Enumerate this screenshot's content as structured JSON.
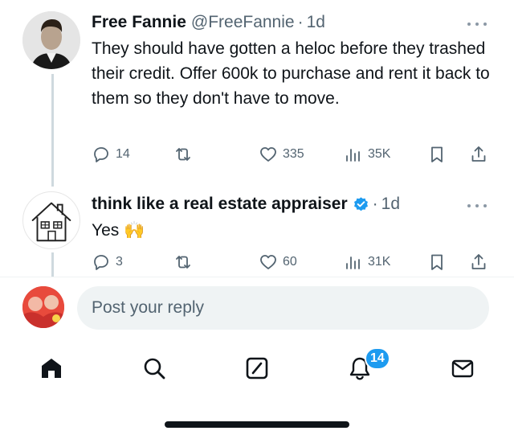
{
  "tweets": [
    {
      "name": "Free Fannie",
      "handle": "@FreeFannie",
      "separator": "·",
      "time": "1d",
      "text": "They should have gotten a heloc before they trashed their credit. Offer 600k to purchase and rent it back to them so they don't have to move.",
      "replies": "14",
      "likes": "335",
      "views": "35K",
      "avatar_icon": "user-photo-avatar"
    },
    {
      "name": "think like a real estate appraiser",
      "verified": true,
      "separator": "·",
      "time": "1d",
      "text": "Yes 🙌",
      "replies": "3",
      "likes": "60",
      "views": "31K",
      "avatar_icon": "house-sketch-avatar"
    }
  ],
  "reply_bar": {
    "placeholder": "Post your reply"
  },
  "tabbar": {
    "items": [
      "home-icon",
      "search-icon",
      "grok-icon",
      "notifications-icon",
      "messages-icon"
    ],
    "notification_count": "14"
  },
  "colors": {
    "text": "#0f1419",
    "secondary": "#536471",
    "accent": "#1d9bf0",
    "input_bg": "#eff3f4"
  }
}
